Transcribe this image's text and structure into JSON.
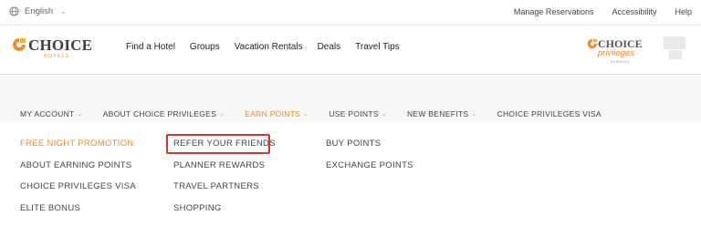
{
  "utility": {
    "language": "English",
    "links": [
      "Manage Reservations",
      "Accessibility",
      "Help"
    ]
  },
  "brand": {
    "name": "CHOICE",
    "sub": "HOTELS"
  },
  "main_nav": [
    "Find a Hotel",
    "Groups",
    "Vacation Rentals",
    "Deals",
    "Travel Tips"
  ],
  "privileges_logo": {
    "name": "CHOICE",
    "sub": "privileges",
    "tiny": "REWARDS"
  },
  "sub_nav": [
    {
      "label": "MY ACCOUNT",
      "chevron": true,
      "active": false
    },
    {
      "label": "ABOUT CHOICE PRIVILEGES",
      "chevron": true,
      "active": false
    },
    {
      "label": "EARN POINTS",
      "chevron": true,
      "active": true
    },
    {
      "label": "USE POINTS",
      "chevron": true,
      "active": false
    },
    {
      "label": "NEW BENEFITS",
      "chevron": true,
      "active": false
    },
    {
      "label": "CHOICE PRIVILEGES VISA",
      "chevron": false,
      "active": false
    }
  ],
  "dropdown": {
    "col1": [
      "FREE NIGHT PROMOTION",
      "ABOUT EARNING POINTS",
      "CHOICE PRIVILEGES VISA",
      "ELITE BONUS"
    ],
    "col2": [
      "REFER YOUR FRIENDS",
      "PLANNER REWARDS",
      "TRAVEL PARTNERS",
      "SHOPPING"
    ],
    "col3": [
      "BUY POINTS",
      "EXCHANGE POINTS"
    ]
  },
  "colors": {
    "accent": "#f28c28",
    "highlight_box": "#d9322f"
  }
}
